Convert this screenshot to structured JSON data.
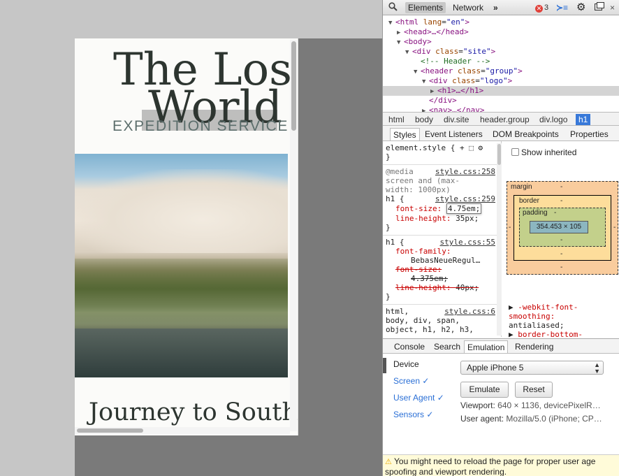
{
  "site": {
    "title_line1": "The Los",
    "title_line2": "World",
    "subtitle": "EXPEDITION SERVICE",
    "article_title": "Journey to South"
  },
  "toolbar": {
    "elements": "Elements",
    "network": "Network",
    "more": "»",
    "error_count": "3"
  },
  "dom_tree": [
    {
      "indent": 0,
      "tri": "▼",
      "tag_open": "<html",
      "attr": "lang",
      "val": "\"en\"",
      "tag_close": ">"
    },
    {
      "indent": 1,
      "tri": "▶",
      "text": "<head>…</head>"
    },
    {
      "indent": 1,
      "tri": "▼",
      "text": "<body>"
    },
    {
      "indent": 2,
      "tri": "▼",
      "tag_open": "<div",
      "attr": "class",
      "val": "\"site\"",
      "tag_close": ">"
    },
    {
      "indent": 3,
      "tri": "",
      "comment": "<!-- Header -->"
    },
    {
      "indent": 3,
      "tri": "▼",
      "tag_open": "<header",
      "attr": "class",
      "val": "\"group\"",
      "tag_close": ">"
    },
    {
      "indent": 4,
      "tri": "▼",
      "tag_open": "<div",
      "attr": "class",
      "val": "\"logo\"",
      "tag_close": ">"
    },
    {
      "indent": 5,
      "tri": "▶",
      "text": "<h1>…</h1>",
      "selected": true
    },
    {
      "indent": 4,
      "tri": "",
      "text": "</div>"
    },
    {
      "indent": 4,
      "tri": "▶",
      "text": "<nav>…</nav>"
    }
  ],
  "breadcrumbs": [
    "html",
    "body",
    "div.site",
    "header.group",
    "div.logo",
    "h1"
  ],
  "styles_tabs": [
    "Styles",
    "Event Listeners",
    "DOM Breakpoints",
    "Properties"
  ],
  "styles": {
    "element_style": "element.style {",
    "element_style_close": "}",
    "rule1_media": "@media screen and (max-width: 1000px)",
    "rule1_media_l1": "@media",
    "rule1_media_l2": "screen and (max-",
    "rule1_media_l3": "width: 1000px)",
    "rule1_src_media": "style.css:258",
    "rule1_selector": "h1 {",
    "rule1_src": "style.css:259",
    "rule1_p1_name": "font-size:",
    "rule1_p1_val": "4.75em;",
    "rule1_p2_name": "line-height:",
    "rule1_p2_val": "35px;",
    "rule1_close": "}",
    "rule2_selector": "h1 {",
    "rule2_src": "style.css:55",
    "rule2_p1_name": "font-family:",
    "rule2_p1_val": "BebasNeueRegul…",
    "rule2_p2_name": "font-size:",
    "rule2_p2_val": "4.375em;",
    "rule2_p3_name": "line-height:",
    "rule2_p3_val": "40px;",
    "rule2_close": "}",
    "rule3_selector_l1": "html,",
    "rule3_selector_l2": "body, div, span,",
    "rule3_selector_l3": "object, h1, h2, h3,",
    "rule3_src": "style.css:6"
  },
  "metrics": {
    "show_inherited": "Show inherited",
    "margin_label": "margin",
    "border_label": "border",
    "padding_label": "padding",
    "dash": "-",
    "content_size": "354.453 × 105",
    "prop1_name": "-webkit-font-",
    "prop1_name2": "smoothing:",
    "prop1_val": "antialiased;",
    "prop2_name": "border-bottom-"
  },
  "drawer_tabs": [
    "Console",
    "Search",
    "Emulation",
    "Rendering"
  ],
  "emulation": {
    "nav_device": "Device",
    "nav_screen": "Screen ✓",
    "nav_user_agent": "User Agent ✓",
    "nav_sensors": "Sensors ✓",
    "device_selected": "Apple iPhone 5",
    "emulate_label": "Emulate",
    "reset_label": "Reset",
    "viewport_label": "Viewport:",
    "viewport_value": "640 × 1136, devicePixelR…",
    "user_agent_label": "User agent:",
    "user_agent_value": "Mozilla/5.0 (iPhone; CP…"
  },
  "warning": {
    "line1": "You might need to reload the page for proper user age",
    "line2": "spoofing and viewport rendering."
  }
}
